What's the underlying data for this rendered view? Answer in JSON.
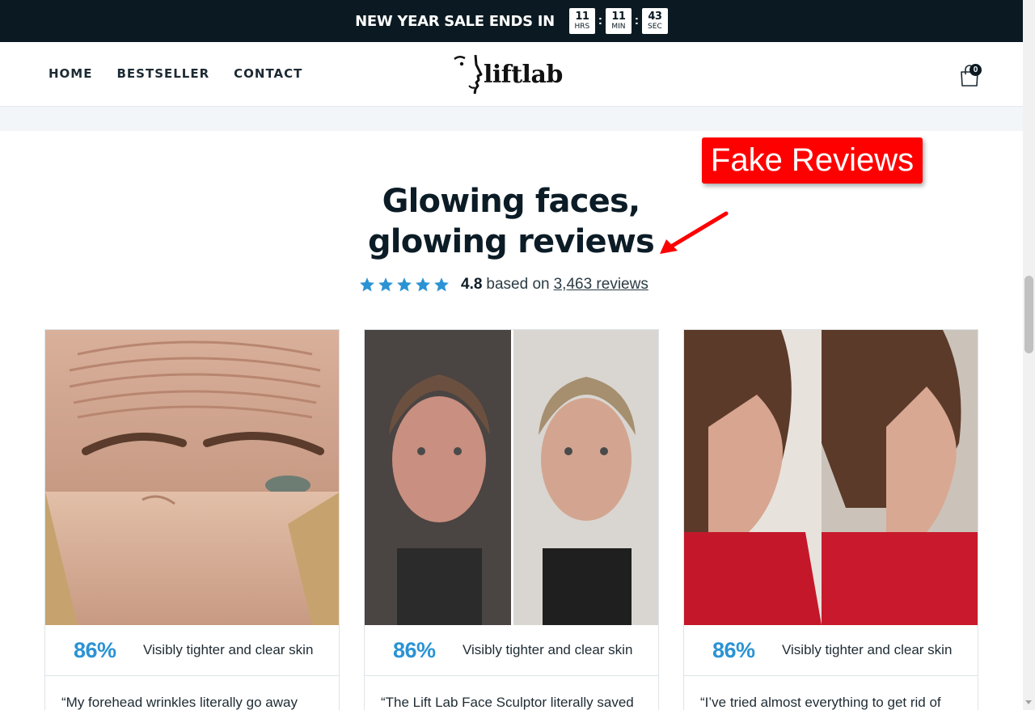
{
  "announcement": {
    "text": "NEW YEAR SALE ENDS IN",
    "timer": [
      {
        "value": "11",
        "label": "HRS"
      },
      {
        "value": "11",
        "label": "MIN"
      },
      {
        "value": "43",
        "label": "SEC"
      }
    ],
    "separator": ":"
  },
  "header": {
    "nav": [
      "HOME",
      "BESTSELLER",
      "CONTACT"
    ],
    "logo_text": "liftlab",
    "cart_count": "0",
    "cart_icon": "shopping-bag-icon"
  },
  "section": {
    "title_line1": "Glowing faces,",
    "title_line2": "glowing reviews",
    "rating": {
      "stars": 5,
      "score": "4.8",
      "based_on": "based on",
      "reviews_link": "3,463 reviews",
      "star_color": "#2b93d4"
    }
  },
  "annotation": {
    "label": "Fake Reviews",
    "color": "#ff0000"
  },
  "cards": [
    {
      "percent": "86%",
      "stat": "Visibly tighter and clear skin",
      "quote": "“My forehead wrinkles literally go away"
    },
    {
      "percent": "86%",
      "stat": "Visibly tighter and clear skin",
      "quote": "“The Lift Lab Face Sculptor literally saved"
    },
    {
      "percent": "86%",
      "stat": "Visibly tighter and clear skin",
      "quote": "“I’ve tried almost everything to get rid of"
    }
  ],
  "colors": {
    "announcement_bg": "#0b1a22",
    "accent": "#2b93d4"
  }
}
